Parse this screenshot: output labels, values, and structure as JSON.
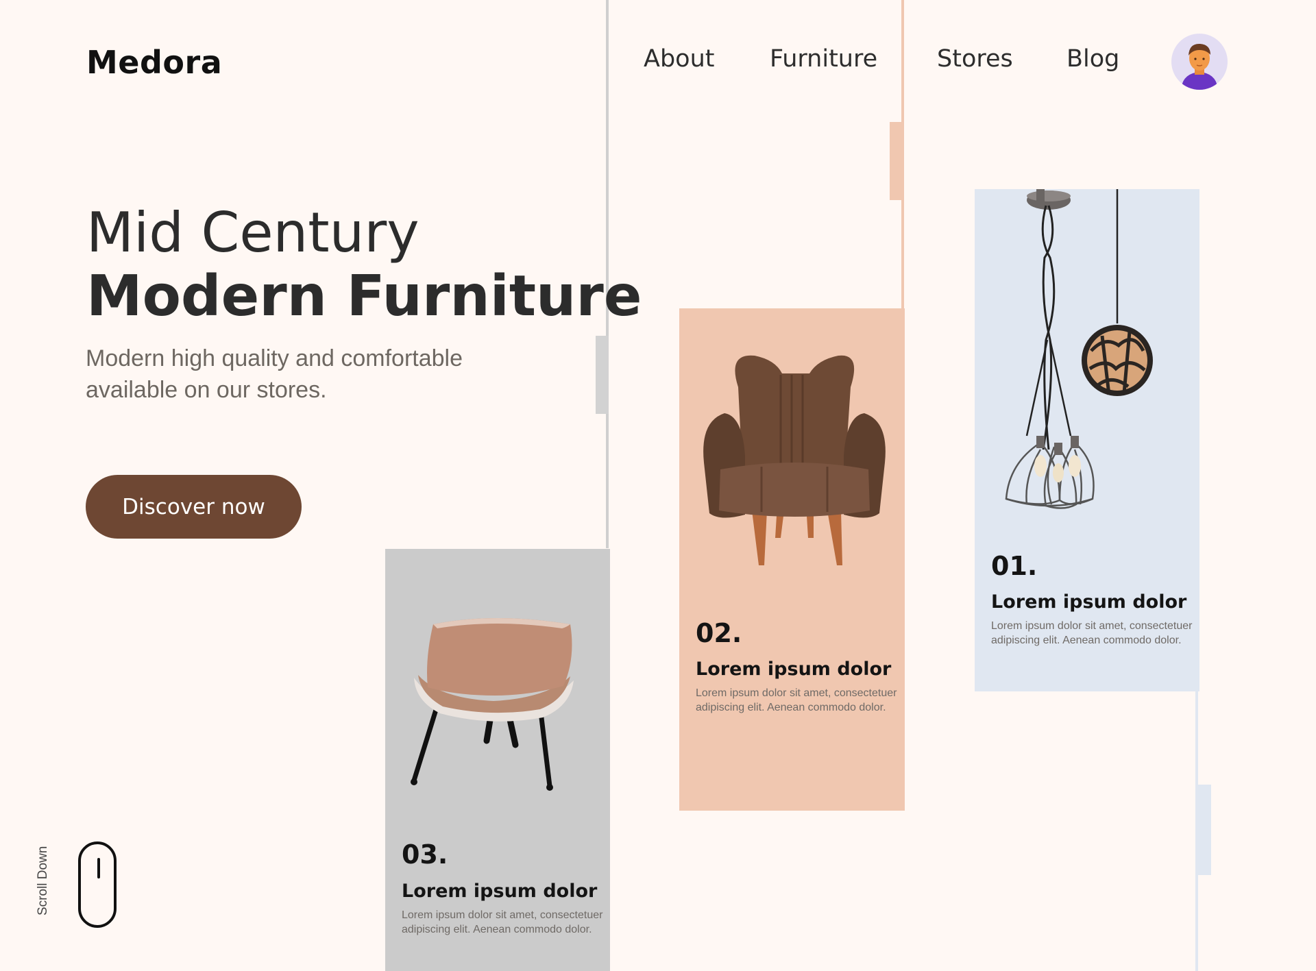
{
  "header": {
    "logo": "Medora",
    "nav": [
      "About",
      "Furniture",
      "Stores",
      "Blog"
    ]
  },
  "hero": {
    "title_light": "Mid Century",
    "title_bold": "Modern Furniture",
    "subtitle": "Modern high quality and comfortable available on our stores.",
    "cta_label": "Discover now"
  },
  "cards": [
    {
      "number": "01.",
      "title": "Lorem ipsum dolor",
      "description": "Lorem ipsum dolor sit amet, consectetuer adipiscing elit. Aenean commodo dolor.",
      "color": "#e0e7f1"
    },
    {
      "number": "02.",
      "title": "Lorem ipsum dolor",
      "description": "Lorem ipsum dolor sit amet, consectetuer adipiscing elit. Aenean commodo dolor.",
      "color": "#f0c7b0"
    },
    {
      "number": "03.",
      "title": "Lorem ipsum dolor",
      "description": "Lorem ipsum dolor sit amet, consectetuer adipiscing elit. Aenean commodo dolor.",
      "color": "#cbcbcb"
    }
  ],
  "scroll_label": "Scroll Down",
  "colors": {
    "background": "#fff8f4",
    "button": "#6e4733",
    "gray_strip": "#cccccc",
    "peach_strip": "#f0c7b0",
    "blue_strip": "#e0e7f1"
  }
}
